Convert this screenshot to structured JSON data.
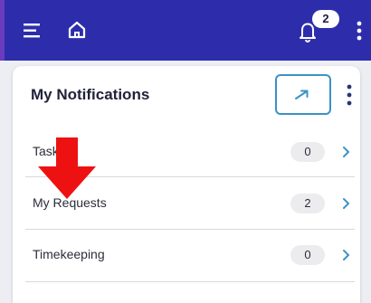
{
  "header": {
    "notification_count": "2",
    "icons": [
      "menu-icon",
      "home-icon",
      "bell-icon",
      "more-vertical-icon"
    ],
    "background_color": "#2d2dac"
  },
  "card": {
    "title": "My Notifications",
    "icons": [
      "arrow-right-icon",
      "more-vertical-icon"
    ],
    "items": [
      {
        "label": "Tasks",
        "count": "0"
      },
      {
        "label": "My Requests",
        "count": "2"
      },
      {
        "label": "Timekeeping",
        "count": "0"
      }
    ]
  },
  "annotation": {
    "icon": "red-arrow-down-icon",
    "color": "#ee1111"
  }
}
